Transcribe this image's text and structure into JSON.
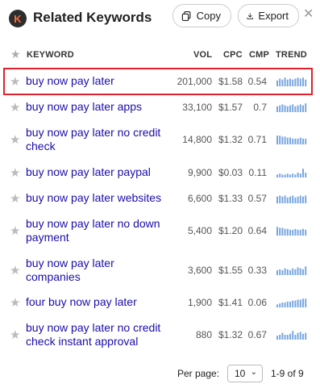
{
  "header": {
    "logo_letter": "K",
    "title": "Related Keywords",
    "copy_label": "Copy",
    "export_label": "Export",
    "close_glyph": "✕"
  },
  "columns": {
    "keyword": "KEYWORD",
    "vol": "VOL",
    "cpc": "CPC",
    "cmp": "CMP",
    "trend": "TREND"
  },
  "rows": [
    {
      "keyword": "buy now pay later",
      "vol": "201,000",
      "cpc": "$1.58",
      "cmp": "0.54",
      "trend": [
        0.6,
        0.8,
        0.7,
        0.9,
        0.7,
        0.8,
        0.7,
        0.8,
        0.9,
        0.8,
        0.9,
        0.7
      ]
    },
    {
      "keyword": "buy now pay later apps",
      "vol": "33,100",
      "cpc": "$1.57",
      "cmp": "0.7",
      "trend": [
        0.6,
        0.7,
        0.8,
        0.7,
        0.6,
        0.7,
        0.8,
        0.6,
        0.7,
        0.8,
        0.7,
        0.9
      ]
    },
    {
      "keyword": "buy now pay later no credit check",
      "vol": "14,800",
      "cpc": "$1.32",
      "cmp": "0.71",
      "trend": [
        0.9,
        0.9,
        0.8,
        0.8,
        0.7,
        0.7,
        0.6,
        0.6,
        0.6,
        0.7,
        0.6,
        0.6
      ]
    },
    {
      "keyword": "buy now pay later paypal",
      "vol": "9,900",
      "cpc": "$0.03",
      "cmp": "0.11",
      "trend": [
        0.3,
        0.4,
        0.3,
        0.3,
        0.4,
        0.3,
        0.4,
        0.3,
        0.5,
        0.4,
        0.9,
        0.5
      ]
    },
    {
      "keyword": "buy now pay later websites",
      "vol": "6,600",
      "cpc": "$1.33",
      "cmp": "0.57",
      "trend": [
        0.7,
        0.8,
        0.7,
        0.8,
        0.6,
        0.7,
        0.8,
        0.6,
        0.7,
        0.8,
        0.7,
        0.8
      ]
    },
    {
      "keyword": "buy now pay later no down payment",
      "vol": "5,400",
      "cpc": "$1.20",
      "cmp": "0.64",
      "trend": [
        0.9,
        0.8,
        0.8,
        0.7,
        0.7,
        0.6,
        0.6,
        0.7,
        0.6,
        0.6,
        0.7,
        0.6
      ]
    },
    {
      "keyword": "buy now pay later companies",
      "vol": "3,600",
      "cpc": "$1.55",
      "cmp": "0.33",
      "trend": [
        0.5,
        0.6,
        0.5,
        0.7,
        0.6,
        0.5,
        0.7,
        0.6,
        0.8,
        0.7,
        0.6,
        0.9
      ]
    },
    {
      "keyword": "four buy now pay later",
      "vol": "1,900",
      "cpc": "$1.41",
      "cmp": "0.06",
      "trend": [
        0.3,
        0.4,
        0.5,
        0.5,
        0.6,
        0.6,
        0.7,
        0.7,
        0.8,
        0.8,
        0.9,
        0.9
      ]
    },
    {
      "keyword": "buy now pay later no credit check instant approval",
      "vol": "880",
      "cpc": "$1.32",
      "cmp": "0.67",
      "trend": [
        0.4,
        0.5,
        0.7,
        0.5,
        0.5,
        0.6,
        0.9,
        0.5,
        0.7,
        0.8,
        0.6,
        0.7
      ]
    }
  ],
  "footer": {
    "per_page_label": "Per page:",
    "per_page_value": "10",
    "range": "1-9 of 9"
  },
  "colors": {
    "link": "#1a0dab",
    "trend_bar": "#7aa7e0",
    "highlight": "#e0202a"
  }
}
